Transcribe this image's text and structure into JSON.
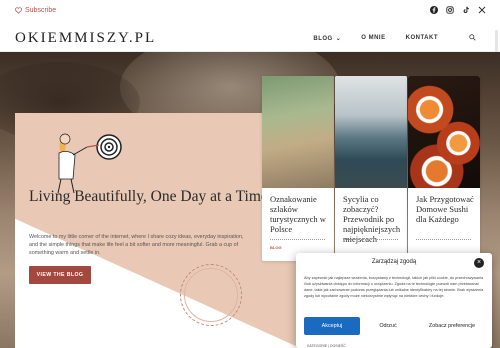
{
  "topbar": {
    "subscribe_label": "Subscribe",
    "social": [
      "facebook-icon",
      "instagram-icon",
      "tiktok-icon",
      "x-icon"
    ]
  },
  "header": {
    "logo": "OKIEMMISZY.PL",
    "nav": [
      {
        "label": "BLOG"
      },
      {
        "label": "O MNIE"
      },
      {
        "label": "KONTAKT"
      }
    ]
  },
  "hero": {
    "title": "Living Beautifully, One Day at a Time",
    "text": "Welcome to my little corner of the internet, where I share cozy ideas, everyday inspiration, and the simple things that make life feel a bit softer and more meaningful. Grab a cup of something warm and settle in.",
    "cta": "VIEW THE BLOG"
  },
  "cards": [
    {
      "title": "Oznakowanie szlaków turystycznych w Polsce",
      "tag": "BLOG"
    },
    {
      "title": "Sycylia co zobaczyć? Przewodnik po najpiękniejszych miejscach",
      "tag": ""
    },
    {
      "title": "Jak Przygotować Domowe Sushi dla Każdego",
      "tag": ""
    }
  ],
  "cookie": {
    "title": "Zarządzaj zgodą",
    "body": "Aby zapewnić jak najlepsze wrażenia, korzystamy z technologii, takich jak pliki cookie, do przechowywania i/lub uzyskiwania dostępu do informacji o urządzeniu. Zgoda na te technologie pozwoli nam przetwarzać dane, takie jak zachowanie podczas przeglądania lub unikalne identyfikatory na tej stronie. Brak wyrażenia zgody lub wycofanie zgody może niekorzystnie wpłynąć na niektóre cechy i funkcje.",
    "accept": "Akceptuj",
    "reject": "Odrzuć",
    "prefs": "Zobacz preferencje"
  },
  "footnote": "KATEGORIE | DOSIEŚĆ",
  "colors": {
    "accent": "#a3483e",
    "cookie_accept": "#1a6bc0"
  }
}
